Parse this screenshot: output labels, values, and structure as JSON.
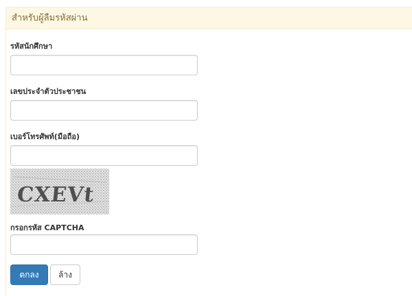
{
  "panel": {
    "title": "สำหรับผู้ลืมรหัสผ่าน"
  },
  "form": {
    "student_id_label": "รหัสนักศึกษา",
    "student_id_value": "",
    "citizen_id_label": "เลขประจำตัวประชาชน",
    "citizen_id_value": "",
    "phone_label": "เบอร์โทรศัพท์(มือถือ)",
    "phone_value": "",
    "captcha_image_text": "CXEVt",
    "captcha_label": "กรอกรหัส CAPTCHA",
    "captcha_value": ""
  },
  "buttons": {
    "submit_label": "ตกลง",
    "reset_label": "ล้าง"
  },
  "colors": {
    "panel_heading_bg": "#fcf8e3",
    "panel_heading_text": "#8a6d3b",
    "primary_button": "#337ab7"
  }
}
